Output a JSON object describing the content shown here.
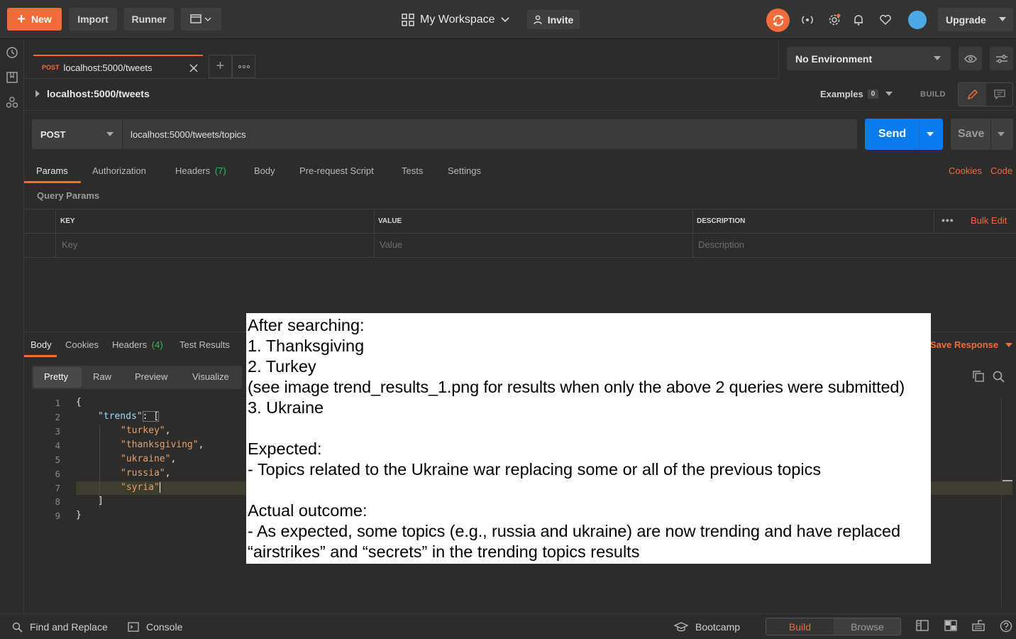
{
  "topbar": {
    "new_label": "New",
    "import_label": "Import",
    "runner_label": "Runner",
    "workspace_label": "My Workspace",
    "invite_label": "Invite",
    "upgrade_label": "Upgrade"
  },
  "tabs": [
    {
      "method": "POST",
      "title": "localhost:5000/tweets"
    }
  ],
  "environment": {
    "selected": "No Environment"
  },
  "request": {
    "title": "localhost:5000/tweets",
    "examples_label": "Examples",
    "examples_count": "0",
    "build_label": "BUILD",
    "method": "POST",
    "url": "localhost:5000/tweets/topics",
    "send_label": "Send",
    "save_label": "Save"
  },
  "request_tabs": {
    "params": "Params",
    "authorization": "Authorization",
    "headers": "Headers",
    "headers_count": "(7)",
    "body": "Body",
    "prerequest": "Pre-request Script",
    "tests": "Tests",
    "settings": "Settings",
    "cookies": "Cookies",
    "code": "Code"
  },
  "query_params": {
    "title": "Query Params",
    "columns": [
      "KEY",
      "VALUE",
      "DESCRIPTION"
    ],
    "placeholders": [
      "Key",
      "Value",
      "Description"
    ],
    "bulk_edit": "Bulk Edit"
  },
  "response": {
    "tabs": {
      "body": "Body",
      "cookies": "Cookies",
      "headers": "Headers",
      "headers_count": "(4)",
      "test_results": "Test Results"
    },
    "save_response": "Save Response",
    "formats": [
      "Pretty",
      "Raw",
      "Preview",
      "Visualize"
    ],
    "line_numbers": [
      "1",
      "2",
      "3",
      "4",
      "5",
      "6",
      "7",
      "8",
      "9"
    ],
    "code": {
      "l1": "{",
      "trends_key": "\"trends\"",
      "colon_bracket": ": [",
      "v1": "\"turkey\"",
      "v2": "\"thanksgiving\"",
      "v3": "\"ukraine\"",
      "v4": "\"russia\"",
      "v5": "\"syria\"",
      "comma": ",",
      "l8": "]",
      "l9": "}"
    }
  },
  "note": {
    "lines": [
      "After searching:",
      "1. Thanksgiving",
      "2. Turkey",
      "(see image trend_results_1.png for results when only the above 2 queries were submitted)",
      "3. Ukraine",
      "",
      "Expected:",
      "- Topics related to the Ukraine war replacing some or all of the previous topics",
      "",
      "Actual outcome:",
      "- As expected, some topics (e.g., russia and ukraine) are now trending and have replaced",
      "“airstrikes” and “secrets” in the trending topics results"
    ]
  },
  "bottombar": {
    "find_replace": "Find and Replace",
    "console": "Console",
    "bootcamp": "Bootcamp",
    "build": "Build",
    "browse": "Browse"
  },
  "colors": {
    "accent": "#f26b3a",
    "send_blue": "#097bed",
    "background": "#2c2c2c"
  }
}
